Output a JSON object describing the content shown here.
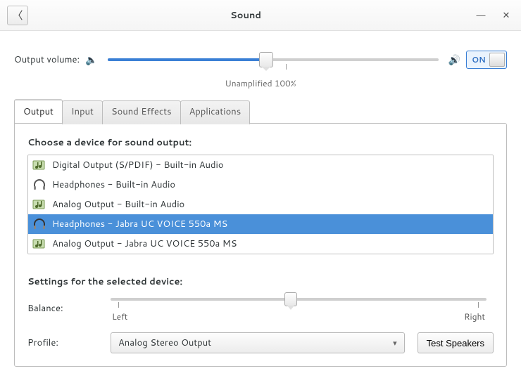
{
  "titlebar": {
    "title": "Sound"
  },
  "volume": {
    "label": "Output volume:",
    "value_pct": 48,
    "toggle_label": "ON",
    "tick_label": "Unamplified  100%",
    "tick_pct": 54
  },
  "tabs": [
    {
      "label": "Output",
      "active": true
    },
    {
      "label": "Input"
    },
    {
      "label": "Sound Effects"
    },
    {
      "label": "Applications"
    }
  ],
  "output": {
    "choose_label": "Choose a device for sound output:",
    "devices": [
      {
        "label": "Digital Output (S/PDIF) - Built-in Audio",
        "icon": "card",
        "selected": false
      },
      {
        "label": "Headphones - Built-in Audio",
        "icon": "headphones",
        "selected": false
      },
      {
        "label": "Analog Output - Built-in Audio",
        "icon": "card",
        "selected": false
      },
      {
        "label": "Headphones - Jabra UC VOICE 550a MS",
        "icon": "headphones",
        "selected": true
      },
      {
        "label": "Analog Output - Jabra UC VOICE 550a MS",
        "icon": "card",
        "selected": false
      }
    ],
    "settings_label": "Settings for the selected device:",
    "balance": {
      "label": "Balance:",
      "left_label": "Left",
      "right_label": "Right",
      "value_pct": 48
    },
    "profile": {
      "label": "Profile:",
      "value": "Analog Stereo Output",
      "test_button": "Test Speakers"
    }
  }
}
